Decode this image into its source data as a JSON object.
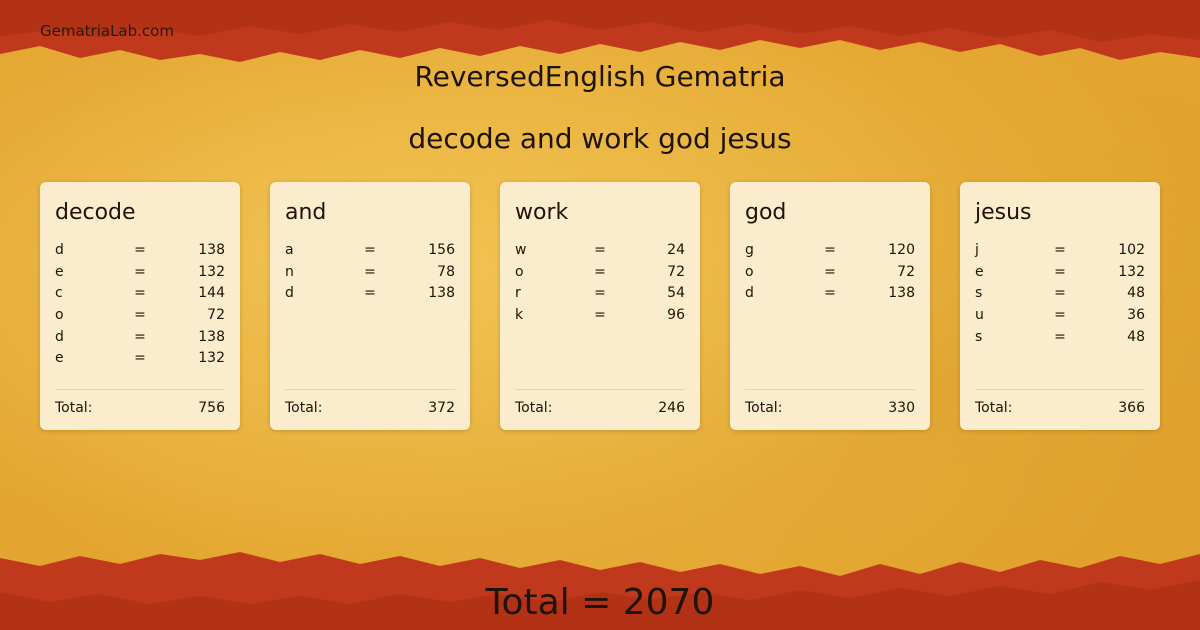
{
  "site_name": "GematriaLab.com",
  "title": "ReversedEnglish Gematria",
  "phrase": "decode and work god jesus",
  "colors": {
    "parchment": "#e9b43a",
    "border_red": "#c0391c",
    "card_bg": "#fbeccd"
  },
  "cards": [
    {
      "word": "decode",
      "letters": [
        {
          "ch": "d",
          "eq": "=",
          "val": "138"
        },
        {
          "ch": "e",
          "eq": "=",
          "val": "132"
        },
        {
          "ch": "c",
          "eq": "=",
          "val": "144"
        },
        {
          "ch": "o",
          "eq": "=",
          "val": "72"
        },
        {
          "ch": "d",
          "eq": "=",
          "val": "138"
        },
        {
          "ch": "e",
          "eq": "=",
          "val": "132"
        }
      ],
      "total_label": "Total:",
      "total": "756"
    },
    {
      "word": "and",
      "letters": [
        {
          "ch": "a",
          "eq": "=",
          "val": "156"
        },
        {
          "ch": "n",
          "eq": "=",
          "val": "78"
        },
        {
          "ch": "d",
          "eq": "=",
          "val": "138"
        }
      ],
      "total_label": "Total:",
      "total": "372"
    },
    {
      "word": "work",
      "letters": [
        {
          "ch": "w",
          "eq": "=",
          "val": "24"
        },
        {
          "ch": "o",
          "eq": "=",
          "val": "72"
        },
        {
          "ch": "r",
          "eq": "=",
          "val": "54"
        },
        {
          "ch": "k",
          "eq": "=",
          "val": "96"
        }
      ],
      "total_label": "Total:",
      "total": "246"
    },
    {
      "word": "god",
      "letters": [
        {
          "ch": "g",
          "eq": "=",
          "val": "120"
        },
        {
          "ch": "o",
          "eq": "=",
          "val": "72"
        },
        {
          "ch": "d",
          "eq": "=",
          "val": "138"
        }
      ],
      "total_label": "Total:",
      "total": "330"
    },
    {
      "word": "jesus",
      "letters": [
        {
          "ch": "j",
          "eq": "=",
          "val": "102"
        },
        {
          "ch": "e",
          "eq": "=",
          "val": "132"
        },
        {
          "ch": "s",
          "eq": "=",
          "val": "48"
        },
        {
          "ch": "u",
          "eq": "=",
          "val": "36"
        },
        {
          "ch": "s",
          "eq": "=",
          "val": "48"
        }
      ],
      "total_label": "Total:",
      "total": "366"
    }
  ],
  "grand_total": "Total = 2070"
}
